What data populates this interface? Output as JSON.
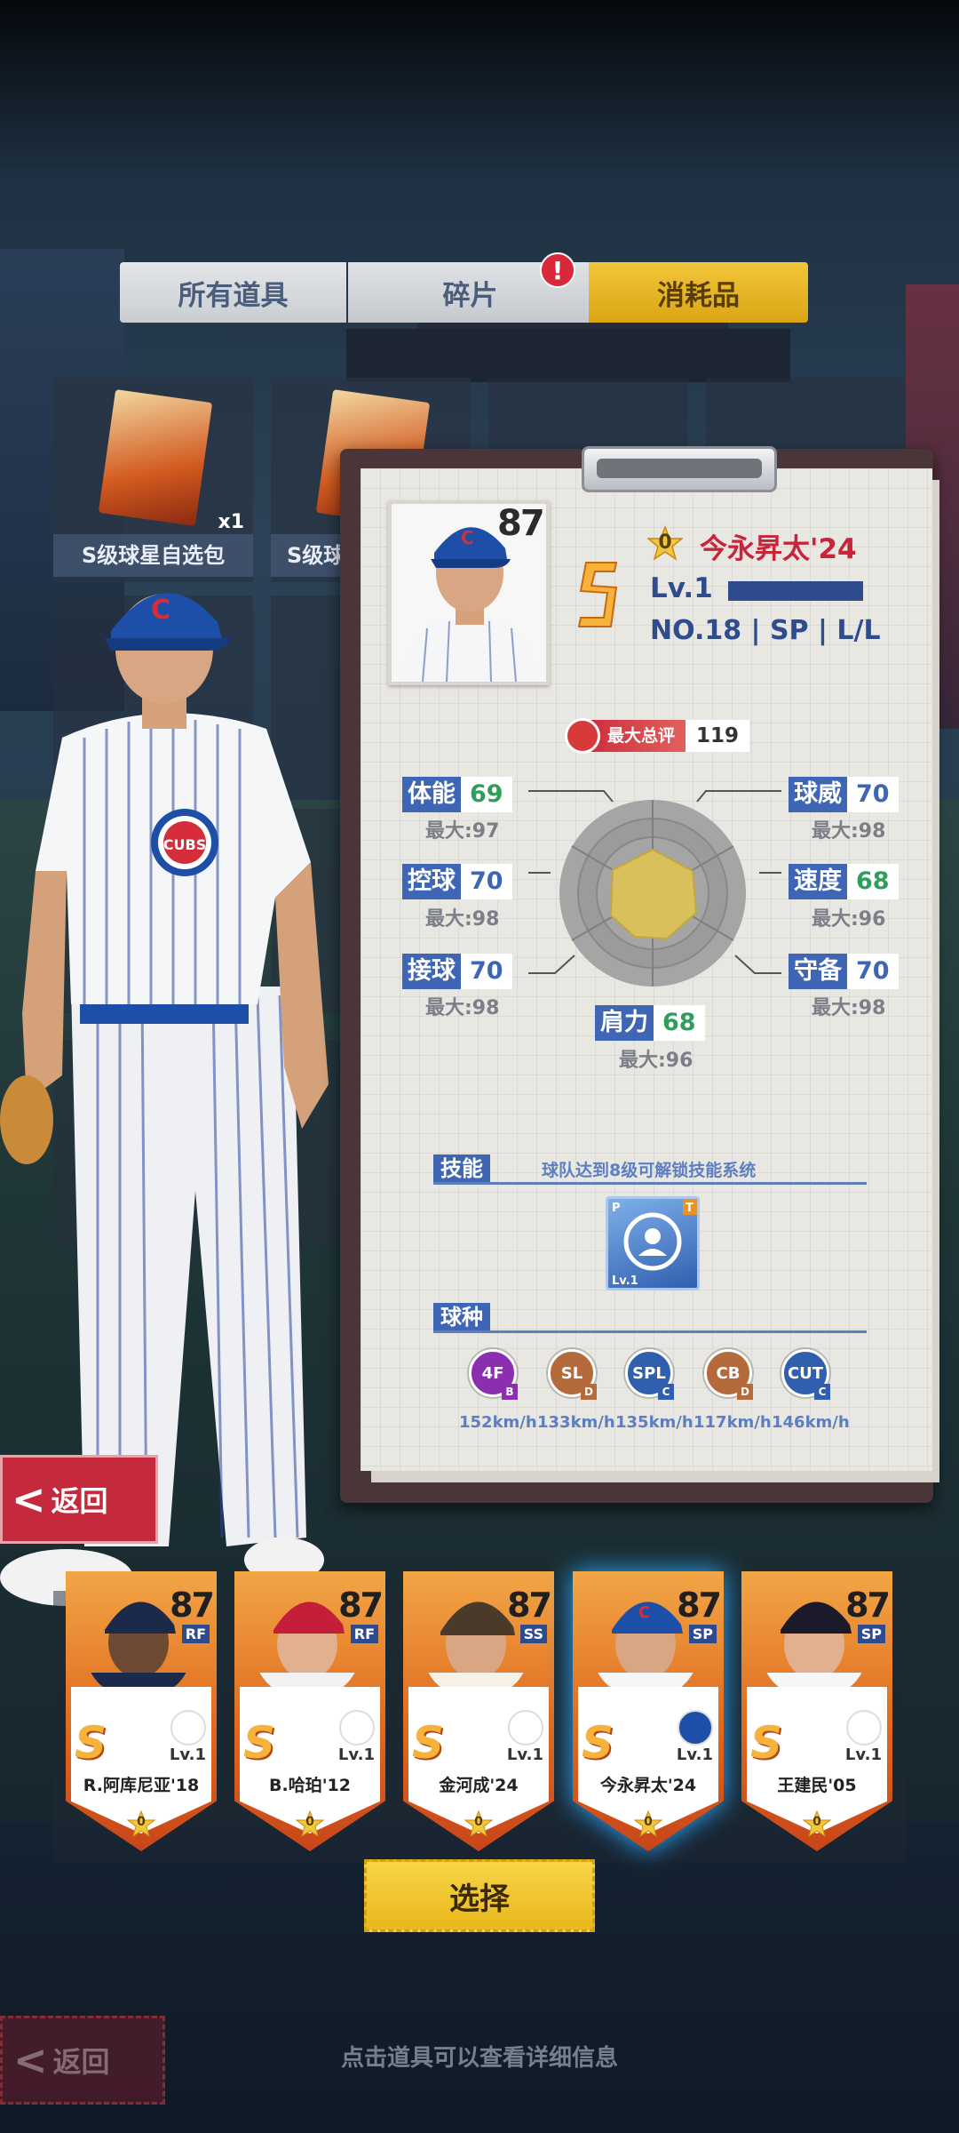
{
  "tabs": {
    "all_items": "所有道具",
    "fragments": "碎片",
    "consumables": "消耗品",
    "badge": "!"
  },
  "item_grid": {
    "tiles": [
      {
        "name": "S级球星自选包",
        "count": "x1"
      },
      {
        "name": "S级球",
        "count": ""
      }
    ]
  },
  "player_detail": {
    "portrait_rating": "87",
    "grade": "S",
    "stars": "0",
    "name": "今永昇太'24",
    "level": "Lv.1",
    "info": "NO.18 | SP |   L/L",
    "overall_label": "最大总评",
    "overall_value": "119",
    "stats": {
      "stamina": {
        "label": "体能",
        "value": "69",
        "max": "最大:97"
      },
      "control": {
        "label": "控球",
        "value": "70",
        "max": "最大:98"
      },
      "catch": {
        "label": "接球",
        "value": "70",
        "max": "最大:98"
      },
      "arm": {
        "label": "肩力",
        "value": "68",
        "max": "最大:96"
      },
      "power": {
        "label": "球威",
        "value": "70",
        "max": "最大:98"
      },
      "speed": {
        "label": "速度",
        "value": "68",
        "max": "最大:96"
      },
      "defense": {
        "label": "守备",
        "value": "70",
        "max": "最大:98"
      }
    },
    "skill": {
      "label": "技能",
      "hint": "球队达到8级可解锁技能系统",
      "icon_level": "Lv.1",
      "icon_tag_left": "P",
      "icon_tag_right": "T"
    },
    "pitches": {
      "label": "球种",
      "items": [
        {
          "code": "4F",
          "grade": "B",
          "speed": "152km/h",
          "color": "#8b2fb0"
        },
        {
          "code": "SL",
          "grade": "D",
          "speed": "133km/h",
          "color": "#b46a3a"
        },
        {
          "code": "SPL",
          "grade": "C",
          "speed": "135km/h",
          "color": "#2f5fae"
        },
        {
          "code": "CB",
          "grade": "D",
          "speed": "117km/h",
          "color": "#b46a3a"
        },
        {
          "code": "CUT",
          "grade": "C",
          "speed": "146km/h",
          "color": "#2f5fae"
        }
      ]
    }
  },
  "back_button": {
    "label": "返回"
  },
  "cards": [
    {
      "rating": "87",
      "pos": "RF",
      "grade": "S",
      "level": "Lv.1",
      "name": "R.阿库尼亚'18",
      "stars": "0",
      "selected": false,
      "cap": "#1b2a4a",
      "logo": "braves"
    },
    {
      "rating": "87",
      "pos": "RF",
      "grade": "S",
      "level": "Lv.1",
      "name": "B.哈珀'12",
      "stars": "0",
      "selected": false,
      "cap": "#c41e3a",
      "logo": "nationals"
    },
    {
      "rating": "87",
      "pos": "SS",
      "grade": "S",
      "level": "Lv.1",
      "name": "金河成'24",
      "stars": "0",
      "selected": false,
      "cap": "#4a3a2a",
      "logo": "padres"
    },
    {
      "rating": "87",
      "pos": "SP",
      "grade": "S",
      "level": "Lv.1",
      "name": "今永昇太'24",
      "stars": "0",
      "selected": true,
      "cap": "#1e4fa8",
      "logo": "cubs"
    },
    {
      "rating": "87",
      "pos": "SP",
      "grade": "S",
      "level": "Lv.1",
      "name": "王建民'05",
      "stars": "0",
      "selected": false,
      "cap": "#1a1a2a",
      "logo": "yankees"
    }
  ],
  "select_button": {
    "label": "选择"
  },
  "footer": {
    "back_label": "返回",
    "hint": "点击道具可以查看详细信息"
  },
  "colors": {
    "accent_blue": "#3e66b4",
    "name_red": "#c8243a",
    "gold": "#f2c63a"
  }
}
